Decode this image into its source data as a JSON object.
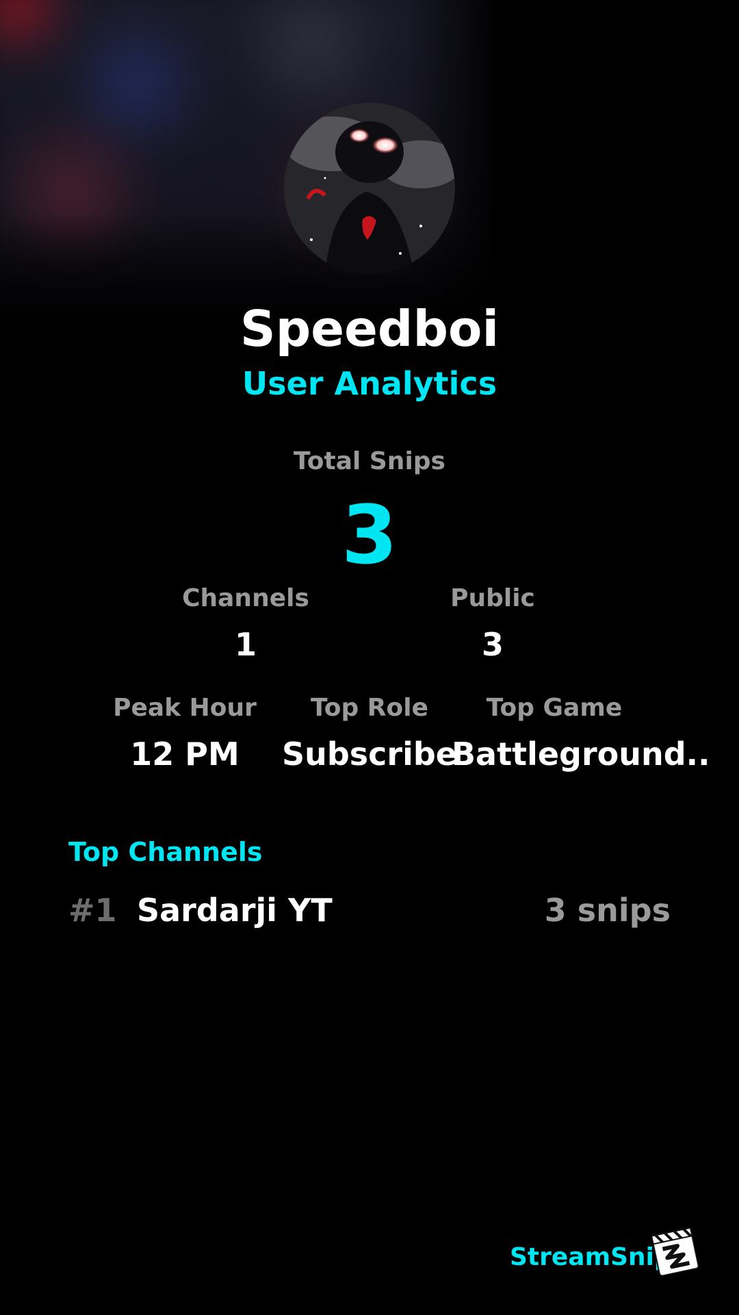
{
  "profile": {
    "username": "Speedboi",
    "subtitle": "User Analytics"
  },
  "summary": {
    "total_label": "Total Snips",
    "total_value": "3"
  },
  "stats_row_1": [
    {
      "label": "Channels",
      "value": "1"
    },
    {
      "label": "Public",
      "value": "3"
    }
  ],
  "stats_row_2": [
    {
      "label": "Peak Hour",
      "value": "12 PM"
    },
    {
      "label": "Top Role",
      "value": "Subscribe"
    },
    {
      "label": "Top Game",
      "value": "Battleground.."
    }
  ],
  "top_channels": {
    "title": "Top Channels",
    "items": [
      {
        "rank": "#1",
        "name": "Sardarji YT",
        "count": "3 snips"
      }
    ]
  },
  "brand": {
    "name": "StreamSnip",
    "logo_icon": "clapperboard-icon"
  },
  "colors": {
    "accent": "#00e5f2",
    "background": "#000000",
    "muted_text": "#9a9a9a"
  }
}
